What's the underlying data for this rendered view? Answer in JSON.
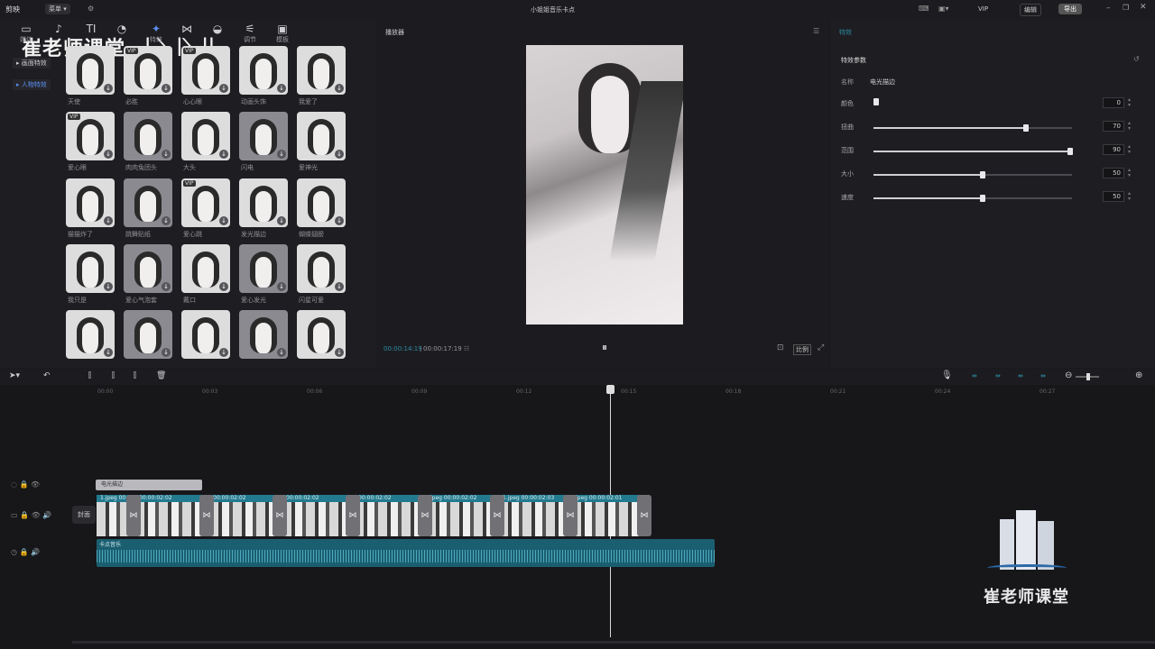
{
  "app": {
    "logo": "剪映",
    "menu": "菜单 ▾",
    "title": "小姐姐音乐卡点",
    "vip": "VIP",
    "btn_a": "编辑",
    "btn_export": "导出"
  },
  "toolbar": {
    "items": [
      {
        "icon": "media-icon",
        "glyph": "▭",
        "label": "媒体"
      },
      {
        "icon": "audio-icon",
        "glyph": "♪",
        "label": ""
      },
      {
        "icon": "text-icon",
        "glyph": "TI",
        "label": ""
      },
      {
        "icon": "sticker-icon",
        "glyph": "◔",
        "label": ""
      },
      {
        "icon": "effects-icon",
        "glyph": "✦",
        "label": "特效"
      },
      {
        "icon": "transition-icon",
        "glyph": "⋈",
        "label": ""
      },
      {
        "icon": "filter-icon",
        "glyph": "◒",
        "label": ""
      },
      {
        "icon": "adjust-icon",
        "glyph": "⚟",
        "label": "调节"
      },
      {
        "icon": "template-icon",
        "glyph": "▣",
        "label": "模板"
      }
    ]
  },
  "watermark": {
    "top": "崔老师课堂",
    "bottom": "崔老师课堂"
  },
  "sidebar": {
    "items": [
      "画面特效",
      "人物特效"
    ]
  },
  "effects": {
    "captions": [
      "天使",
      "必胜",
      "心心眼",
      "动画头饰",
      "我爱了",
      "爱心眼",
      "肉肉兔团头",
      "大头",
      "闪电",
      "爱神光",
      "猫猫炸了",
      "跳舞贴纸",
      "爱心跳",
      "发光描边",
      "蝴蝶翅膀",
      "我只是",
      "爱心气泡套",
      "戴口",
      "爱心发光",
      "闪星可爱",
      "",
      "",
      "",
      "",
      ""
    ]
  },
  "player": {
    "label": "播放器",
    "current_time": "00:00:14:19",
    "total_time": "00:00:17:19",
    "ratio": "比例"
  },
  "params": {
    "panel_title": "特效",
    "section": "特效参数",
    "name_label": "名称",
    "name_value": "电光描边",
    "color_label": "颜色",
    "color_value": "0",
    "sliders": [
      {
        "label": "扭曲",
        "value": "70",
        "pct": 0.77
      },
      {
        "label": "范围",
        "value": "90",
        "pct": 0.99
      },
      {
        "label": "大小",
        "value": "50",
        "pct": 0.55
      },
      {
        "label": "速度",
        "value": "50",
        "pct": 0.55
      }
    ]
  },
  "timeline": {
    "ruler": [
      "00:00",
      "00:03",
      "00:06",
      "00:09",
      "00:12",
      "00:15",
      "00:18",
      "00:21",
      "00:24",
      "00:27"
    ],
    "effect_clip": "电光描边",
    "cover_label": "封面",
    "audio_label": "卡点音乐",
    "clips": [
      {
        "label": "1.jpeg  00:00:02:03"
      },
      {
        "label": "00:00:02:02"
      },
      {
        "label": "00:00:02:02"
      },
      {
        "label": "00:00:02:02"
      },
      {
        "label": "00:00:02:02"
      },
      {
        "label": "jpeg  00:00:02:02"
      },
      {
        "label": "1.jpeg  00:00:02:03"
      },
      {
        "label": "jpeg  00:00:02:01"
      }
    ]
  },
  "colors": {
    "accent": "#2c8ba3",
    "effect_item": "#5b8ef0",
    "clip": "#1b6c80"
  }
}
